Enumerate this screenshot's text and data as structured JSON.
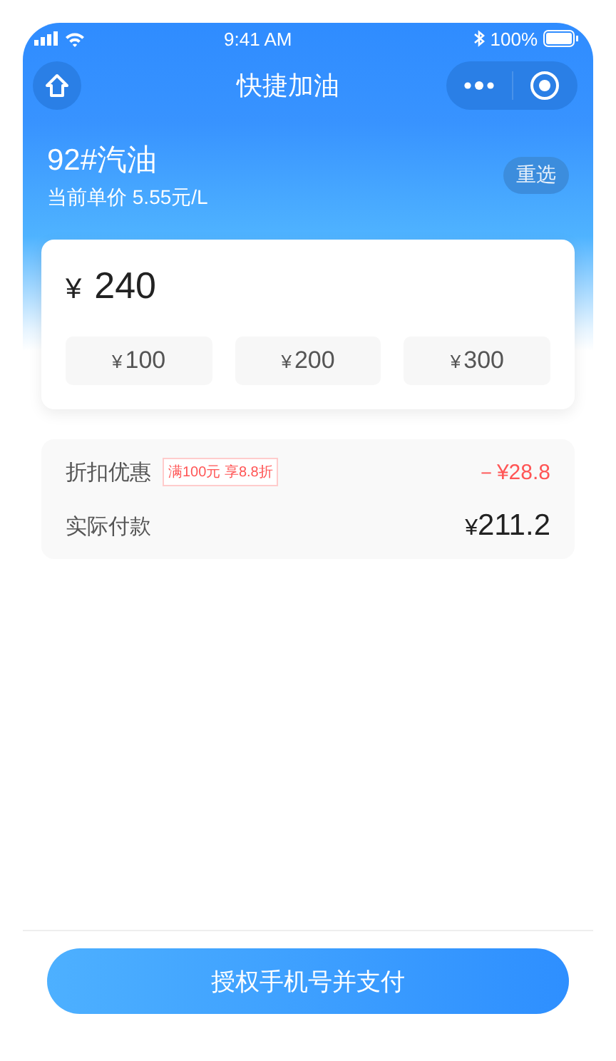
{
  "status_bar": {
    "time": "9:41 AM",
    "battery": "100%"
  },
  "nav": {
    "title": "快捷加油"
  },
  "fuel": {
    "name": "92#汽油",
    "price": "当前单价 5.55元/L",
    "reselect": "重选"
  },
  "amount": {
    "currency": "¥",
    "value": "240"
  },
  "quick_amounts": [
    {
      "currency": "¥",
      "value": "100"
    },
    {
      "currency": "¥",
      "value": "200"
    },
    {
      "currency": "¥",
      "value": "300"
    }
  ],
  "discount": {
    "label": "折扣优惠",
    "tag": "满100元 享8.8折",
    "value": "－¥28.8"
  },
  "payment": {
    "label": "实际付款",
    "currency": "¥",
    "value": "211.2"
  },
  "pay_button": "授权手机号并支付"
}
